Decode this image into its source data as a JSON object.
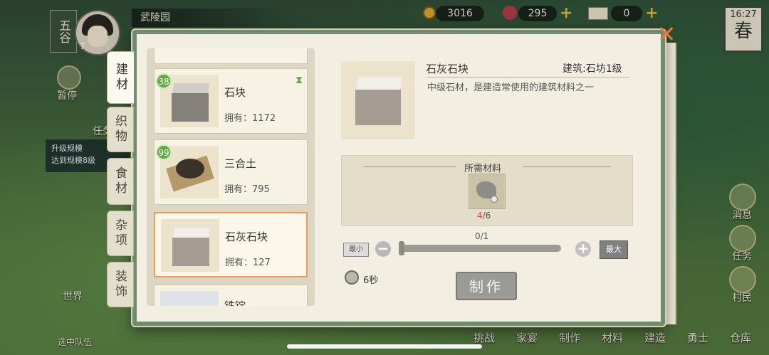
{
  "hud": {
    "player_tag": "五谷",
    "player_level": "7",
    "village_name": "武陵园",
    "coins": "3016",
    "flowers": "295",
    "tickets": "0",
    "time": "16:27",
    "season": "春"
  },
  "left_side": {
    "pause_label": "暂停",
    "task_label": "任务",
    "quest_line1": "升级规模",
    "quest_line2": "达到规模8级",
    "world_label": "世界",
    "team_label": "选中队伍"
  },
  "right_side": {
    "message_label": "消息",
    "task_label": "任务",
    "villager_label": "村民"
  },
  "bottom_bar": [
    "挑战",
    "家宴",
    "制作",
    "材料",
    "建造",
    "勇士",
    "仓库"
  ],
  "dialog": {
    "tabs": [
      "建材",
      "织物",
      "食材",
      "杂项",
      "装饰"
    ],
    "items": [
      {
        "badge": "38",
        "name": "石块",
        "owned": "拥有：1172"
      },
      {
        "badge": "99",
        "name": "三合土",
        "owned": "拥有：795"
      },
      {
        "badge": "",
        "name": "石灰石块",
        "owned": "拥有：127"
      },
      {
        "badge": "",
        "name": "铁锭",
        "owned": ""
      }
    ],
    "detail": {
      "title": "石灰石块",
      "requirement": "建筑:石坊1级",
      "description": "中级石材，是建造常使用的建筑材料之一"
    },
    "materials": {
      "title": "所需材料",
      "have": "4",
      "need": "/6"
    },
    "quantity": "0/1",
    "min_label": "最小",
    "max_label": "最大",
    "duration": "6秒",
    "craft_label": "制作",
    "close": "✕"
  }
}
